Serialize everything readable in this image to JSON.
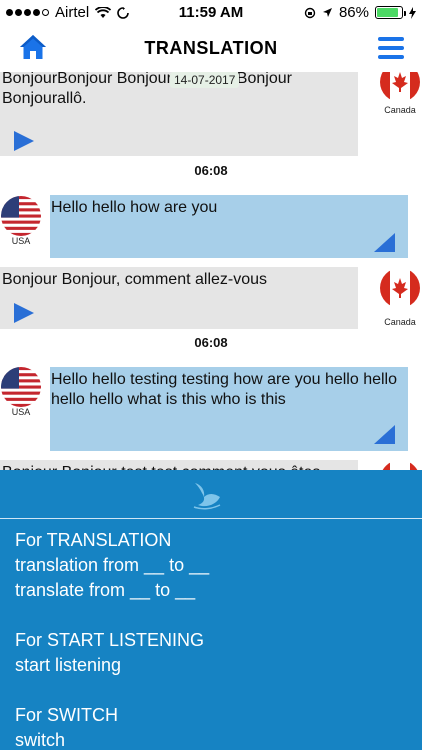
{
  "status_bar": {
    "carrier": "Airtel",
    "time": "11:59 AM",
    "battery": "86%",
    "battery_level": 0.86,
    "signal_dots": 4
  },
  "nav": {
    "title": "TRANSLATION",
    "home_icon": "home-icon",
    "menu_icon": "hamburger-icon",
    "accent": "#1a73e8"
  },
  "chat": {
    "date_chip": "14-07-2017",
    "messages": [
      {
        "side": "fr",
        "text": "BonjourBonjour Bonjour test test Bonjour Bonjourallô.",
        "country": "Canada"
      },
      {
        "time": "06:08"
      },
      {
        "side": "en",
        "text": "Hello hello how are you",
        "country": "USA"
      },
      {
        "side": "fr",
        "text": "Bonjour Bonjour, comment allez-vous",
        "country": "Canada"
      },
      {
        "time": "06:08"
      },
      {
        "side": "en",
        "text": "Hello hello testing testing how are you hello hello hello hello what is this who is this",
        "country": "USA"
      },
      {
        "side": "fr",
        "text": "Bonjour Bonjour test test comment vous êtes",
        "country": "Canada"
      }
    ],
    "colors": {
      "fr_bubble": "#e5e5e5",
      "en_bubble": "#a7cfe9",
      "play": "#2a6fd6"
    }
  },
  "help": {
    "background": "#1683c3",
    "icon": "swan-icon",
    "blocks": [
      {
        "title": "For TRANSLATION",
        "lines": [
          "translation from __ to __",
          "translate from __ to __"
        ]
      },
      {
        "title": "For START LISTENING",
        "lines": [
          "start listening"
        ]
      },
      {
        "title": "For SWITCH",
        "lines": [
          "switch"
        ]
      }
    ]
  }
}
